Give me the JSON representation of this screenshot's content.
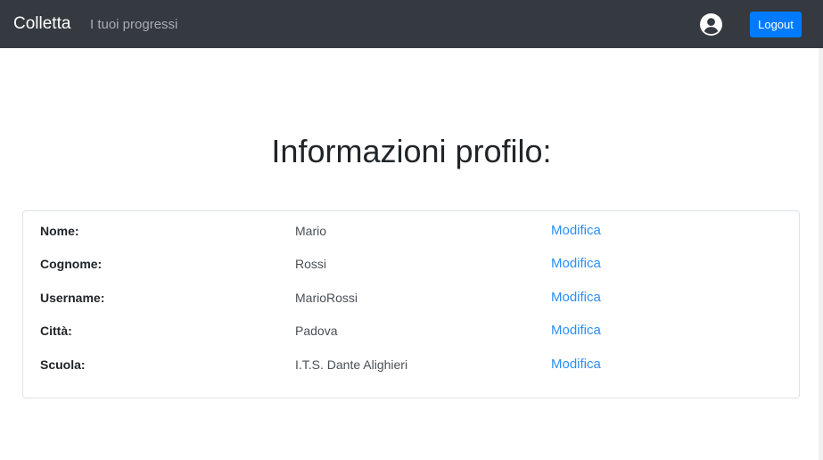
{
  "navbar": {
    "brand": "Colletta",
    "link": "I tuoi progressi",
    "avatar_icon": "user-circle-icon",
    "logout_label": "Logout",
    "background": "#343a40",
    "logout_color": "#007bff"
  },
  "main": {
    "title": "Informazioni profilo:",
    "rows": [
      {
        "label": "Nome:",
        "value": "Mario",
        "action": "Modifica"
      },
      {
        "label": "Cognome:",
        "value": "Rossi",
        "action": "Modifica"
      },
      {
        "label": "Username:",
        "value": "MarioRossi",
        "action": "Modifica"
      },
      {
        "label": "Città:",
        "value": "Padova",
        "action": "Modifica"
      },
      {
        "label": "Scuola:",
        "value": "I.T.S. Dante Alighieri",
        "action": "Modifica"
      }
    ],
    "link_color": "#2d8ef2"
  }
}
